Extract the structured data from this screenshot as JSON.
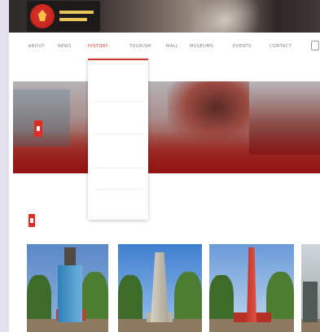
{
  "header": {
    "logo_line1": "",
    "logo_line2": ""
  },
  "nav": {
    "items": [
      {
        "label": "ABOUT",
        "active": false
      },
      {
        "label": "NEWS",
        "active": false
      },
      {
        "label": "HISTORY",
        "active": true
      },
      {
        "label": "TOURISM",
        "active": false
      },
      {
        "label": "MALL",
        "active": false
      },
      {
        "label": "MUSEUMS",
        "active": false
      },
      {
        "label": "EVENTS",
        "active": false
      },
      {
        "label": "CONTACT",
        "active": false
      }
    ]
  },
  "banner": {
    "title": ""
  },
  "dropdown": {
    "items": [
      {
        "label": "",
        "active": false
      },
      {
        "label": "",
        "active": false
      },
      {
        "label": "",
        "active": false
      },
      {
        "label": "",
        "active": false
      },
      {
        "label": "",
        "active": true
      }
    ]
  },
  "section": {
    "title": ""
  },
  "gallery": {
    "items": [
      {
        "alt": "monument-1"
      },
      {
        "alt": "monument-2"
      },
      {
        "alt": "monument-3"
      },
      {
        "alt": "monument-4"
      }
    ]
  },
  "colors": {
    "accent": "#d2362c",
    "header_dark": "#2f2a2a",
    "banner_red": "#8c1a16"
  }
}
